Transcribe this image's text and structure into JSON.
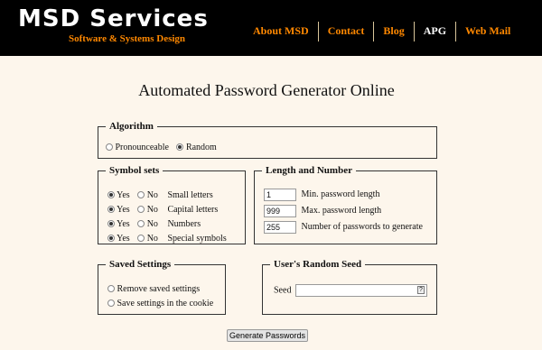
{
  "brand": {
    "name": "MSD Services",
    "tagline": "Software & Systems Design"
  },
  "nav": [
    "About MSD",
    "Contact",
    "Blog",
    "APG",
    "Web Mail"
  ],
  "page_title": "Automated Password Generator Online",
  "algorithm": {
    "legend": "Algorithm",
    "options": [
      "Pronounceable",
      "Random"
    ],
    "selected": "Random"
  },
  "symbol_sets": {
    "legend": "Symbol sets",
    "yes_label": "Yes",
    "no_label": "No",
    "rows": [
      {
        "label": "Small letters",
        "selected": "Yes"
      },
      {
        "label": "Capital letters",
        "selected": "Yes"
      },
      {
        "label": "Numbers",
        "selected": "Yes"
      },
      {
        "label": "Special symbols",
        "selected": "Yes"
      }
    ]
  },
  "length_number": {
    "legend": "Length and Number",
    "fields": [
      {
        "value": "1",
        "label": "Min. password length"
      },
      {
        "value": "999",
        "label": "Max. password length"
      },
      {
        "value": "255",
        "label": "Number of passwords to generate"
      }
    ]
  },
  "saved_settings": {
    "legend": "Saved Settings",
    "options": [
      "Remove saved settings",
      "Save settings in the cookie"
    ]
  },
  "random_seed": {
    "legend": "User's Random Seed",
    "seed_label": "Seed",
    "seed_value": "",
    "hint_glyph": "?"
  },
  "generate_button": "Generate Passwords",
  "colors": {
    "header_bg": "#000000",
    "accent": "#ff8800",
    "page_bg": "#fdf6ec"
  }
}
